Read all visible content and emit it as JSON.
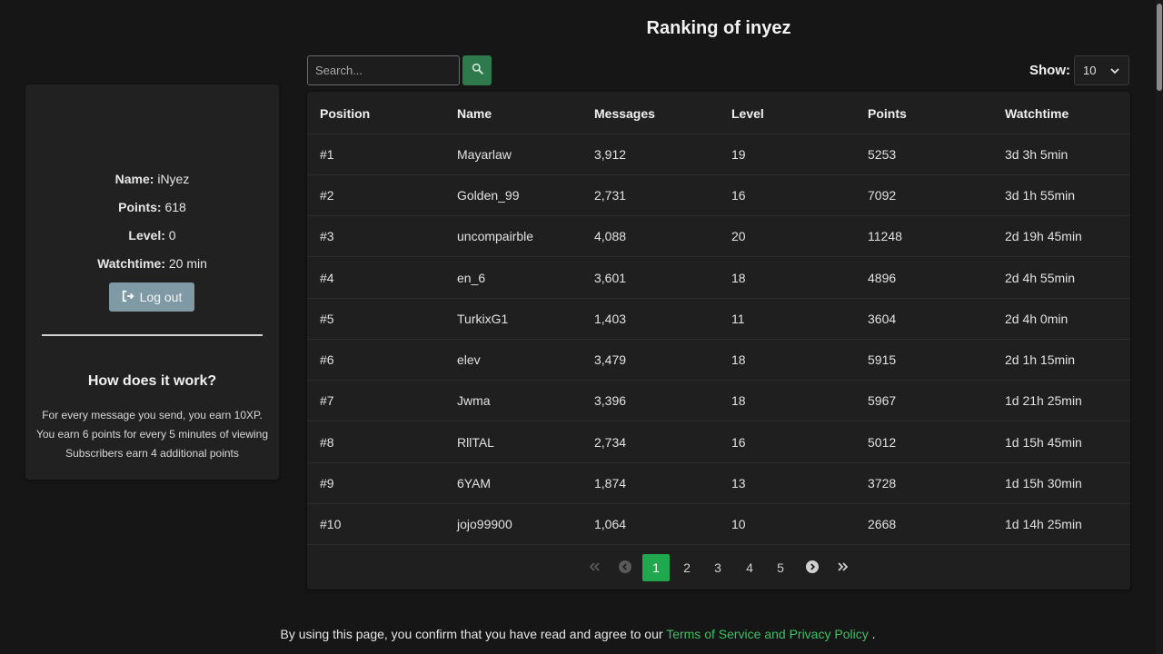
{
  "page": {
    "title": "Ranking of inyez"
  },
  "profile": {
    "name_label": "Name:",
    "name_value": "iNyez",
    "points_label": "Points:",
    "points_value": "618",
    "level_label": "Level:",
    "level_value": "0",
    "watchtime_label": "Watchtime:",
    "watchtime_value": "20 min",
    "logout_label": "Log out"
  },
  "how": {
    "title": "How does it work?",
    "lines": [
      "For every message you send, you earn 10XP.",
      "You earn 6 points for every 5 minutes of viewing",
      "Subscribers earn 4 additional points"
    ]
  },
  "toolbar": {
    "search_placeholder": "Search...",
    "show_label": "Show:",
    "show_value": "10",
    "accent": "#2f7a4d"
  },
  "table": {
    "headers": [
      "Position",
      "Name",
      "Messages",
      "Level",
      "Points",
      "Watchtime"
    ],
    "rows": [
      [
        "#1",
        "Mayarlaw",
        "3,912",
        "19",
        "5253",
        "3d 3h 5min"
      ],
      [
        "#2",
        "Golden_99",
        "2,731",
        "16",
        "7092",
        "3d 1h 55min"
      ],
      [
        "#3",
        "uncompairble",
        "4,088",
        "20",
        "11248",
        "2d 19h 45min"
      ],
      [
        "#4",
        "en_6",
        "3,601",
        "18",
        "4896",
        "2d 4h 55min"
      ],
      [
        "#5",
        "TurkixG1",
        "1,403",
        "11",
        "3604",
        "2d 4h 0min"
      ],
      [
        "#6",
        "elev",
        "3,479",
        "18",
        "5915",
        "2d 1h 15min"
      ],
      [
        "#7",
        "Jwma",
        "3,396",
        "18",
        "5967",
        "1d 21h 25min"
      ],
      [
        "#8",
        "RllTAL",
        "2,734",
        "16",
        "5012",
        "1d 15h 45min"
      ],
      [
        "#9",
        "6YAM",
        "1,874",
        "13",
        "3728",
        "1d 15h 30min"
      ],
      [
        "#10",
        "jojo99900",
        "1,064",
        "10",
        "2668",
        "1d 14h 25min"
      ]
    ]
  },
  "pagination": {
    "pages": [
      "1",
      "2",
      "3",
      "4",
      "5"
    ],
    "active": "1",
    "active_color": "#1fa84d"
  },
  "footer": {
    "text_before": "By using this page, you confirm that you have read and agree to our ",
    "link": "Terms of Service and Privacy Policy",
    "text_after": " ."
  }
}
